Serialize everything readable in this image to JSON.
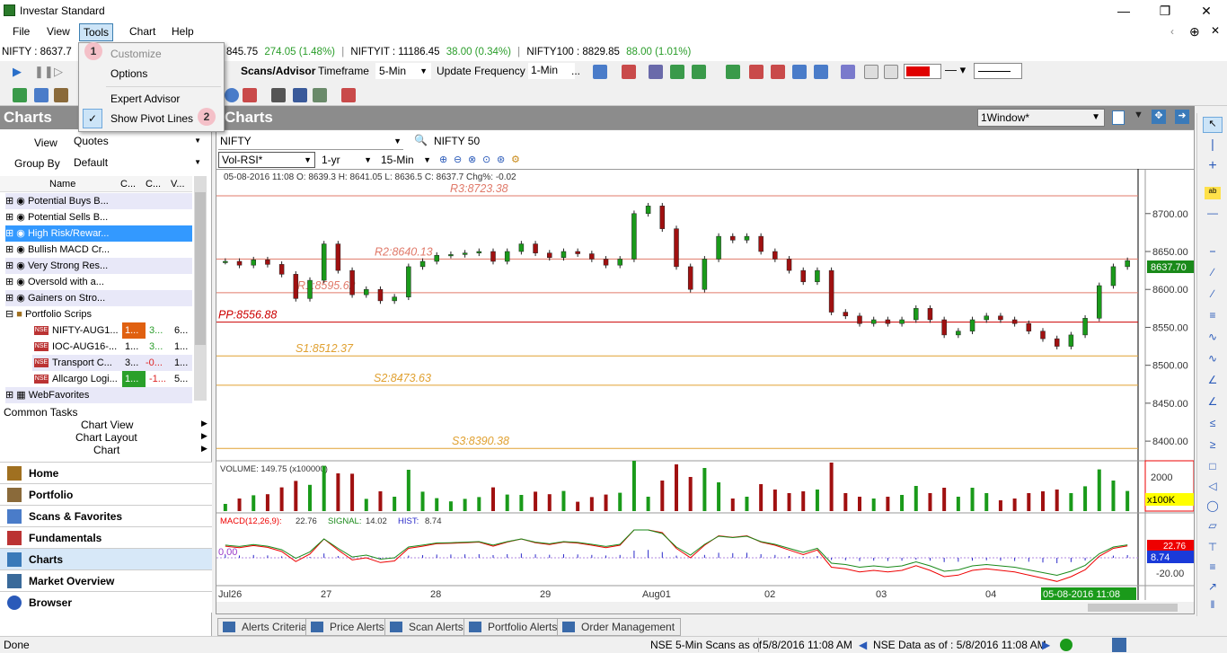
{
  "window": {
    "title": "Investar Standard"
  },
  "menu": {
    "file": "File",
    "view": "View",
    "tools": "Tools",
    "chart": "Chart",
    "help": "Help"
  },
  "tools_menu": {
    "customize": "Customize",
    "options": "Options",
    "expert_advisor": "Expert Advisor",
    "show_pivot_lines": "Show Pivot Lines"
  },
  "annotations": {
    "one": "1",
    "two": "2"
  },
  "ticker": {
    "nifty": "NIFTY : 8637.7",
    "nifty_cont": "845.75",
    "nifty_chg": "274.05 (1.48%)",
    "niftyit": "NIFTYIT : 11186.45",
    "niftyit_chg": "38.00 (0.34%)",
    "nifty100": "NIFTY100 : 8829.85",
    "nifty100_chg": "88.00 (1.01%)"
  },
  "toolbar": {
    "scans": "Scans/Advisor",
    "timeframe_label": "Timeframe",
    "timeframe": "5-Min",
    "update_label": "Update Frequency",
    "update": "1-Min",
    "more": "..."
  },
  "left": {
    "title": "Charts",
    "view_label": "View",
    "view_value": "Quotes",
    "group_label": "Group By",
    "group_value": "Default",
    "col_name": "Name",
    "col_c1": "C...",
    "col_c2": "C...",
    "col_v": "V...",
    "rows": [
      {
        "label": "Potential Buys B..."
      },
      {
        "label": "Potential Sells B..."
      },
      {
        "label": "High Risk/Rewar..."
      },
      {
        "label": "Bullish MACD Cr..."
      },
      {
        "label": "Very Strong Res..."
      },
      {
        "label": "Oversold with a..."
      },
      {
        "label": "Gainers on Stro..."
      },
      {
        "label": "Portfolio Scrips"
      }
    ],
    "scrips": [
      {
        "name": "NIFTY-AUG1...",
        "c1": "1...",
        "c2": "3...",
        "v": "6..."
      },
      {
        "name": "IOC-AUG16-...",
        "c1": "1...",
        "c2": "3...",
        "v": "1..."
      },
      {
        "name": "Transport C...",
        "c1": "3...",
        "c2": "-0...",
        "v": "1..."
      },
      {
        "name": "Allcargo Logi...",
        "c1": "1...",
        "c2": "-1...",
        "v": "5..."
      }
    ],
    "webfav": "WebFavorites",
    "common_tasks": "Common Tasks",
    "ct_view": "Chart View",
    "ct_layout": "Chart Layout",
    "ct_chart": "Chart",
    "nav": [
      "Home",
      "Portfolio",
      "Scans & Favorites",
      "Fundamentals",
      "Charts",
      "Market Overview",
      "Browser"
    ]
  },
  "chart": {
    "header": "Charts",
    "window_select": "1Window*",
    "symbol": "NIFTY",
    "symbol_name": "NIFTY 50",
    "indicator": "Vol-RSI*",
    "period": "1-yr",
    "interval": "15-Min",
    "ohlc": "05-08-2016 11:08   O: 8639.3   H: 8641.05   L: 8636.5   C: 8637.7   Chg%: -0.02",
    "pivots": {
      "r3": "R3:8723.38",
      "r2": "R2:8640.13",
      "r1": "R1:8595.62",
      "pp": "PP:8556.88",
      "s1": "S1:8512.37",
      "s2": "S2:8473.63",
      "s3": "S3:8390.38"
    },
    "last_price": "8637.70",
    "volume_label": "VOLUME: 149.75 (x100000)",
    "vol_scale": "2000",
    "vol_unit": "x100K",
    "macd_label": "MACD(12,26,9):",
    "macd_val": "22.76",
    "signal_label": "SIGNAL:",
    "signal_val": "14.02",
    "hist_label": "HIST:",
    "hist_val": "8.74",
    "macd_zero": "0.00",
    "macd_tag1": "22.76",
    "macd_tag2": "8.74",
    "macd_neg": "-20.00",
    "dates": [
      "Jul26",
      "27",
      "28",
      "29",
      "Aug01",
      "02",
      "03",
      "04"
    ],
    "current_date": "05-08-2016 11:08"
  },
  "chart_data": {
    "type": "line",
    "title": "NIFTY",
    "y_ticks": [
      "8700.00",
      "8650.00",
      "8600.00",
      "8550.00",
      "8500.00",
      "8450.00",
      "8400.00"
    ],
    "ylim": [
      8380,
      8740
    ],
    "x": [
      "Jul26",
      "27",
      "28",
      "29",
      "Aug01",
      "02",
      "03",
      "04",
      "05-08-2016 11:08"
    ],
    "pivots": [
      8723.38,
      8640.13,
      8595.62,
      8556.88,
      8512.37,
      8473.63,
      8390.38
    ],
    "series": [
      {
        "values": [
          8637,
          8632,
          8639,
          8633,
          8620,
          8588,
          8612,
          8660,
          8625,
          8593,
          8600,
          8585,
          8590,
          8630,
          8637,
          8645,
          8646,
          8648,
          8650,
          8637,
          8650,
          8660,
          8648,
          8642,
          8650,
          8647,
          8640,
          8632,
          8640,
          8700,
          8710,
          8680,
          8630,
          8600,
          8640,
          8670,
          8665,
          8670,
          8650,
          8640,
          8625,
          8610,
          8625,
          8570,
          8565,
          8555,
          8560,
          8555,
          8560,
          8575,
          8560,
          8540,
          8545,
          8560,
          8565,
          8560,
          8555,
          8545,
          8535,
          8525,
          8540,
          8562,
          8605,
          8630,
          8638
        ]
      }
    ]
  },
  "bottom_tabs": [
    "Alerts Criteria",
    "Price Alerts",
    "Scan Alerts",
    "Portfolio Alerts",
    "Order Management"
  ],
  "status": {
    "left": "Done",
    "scan": "NSE 5-Min Scans as of",
    "scan_time": "5/8/2016 11:08 AM",
    "data": "NSE Data as of : 5/8/2016 11:08 AM"
  }
}
